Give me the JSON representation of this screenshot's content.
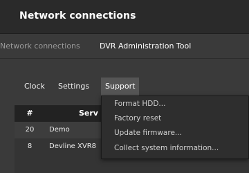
{
  "window": {
    "title": "Network connections"
  },
  "breadcrumbs": [
    "Network connections",
    "DVR Administration Tool"
  ],
  "menubar": {
    "items": [
      "Clock",
      "Settings",
      "Support"
    ],
    "active": "Support"
  },
  "support_menu": {
    "items": [
      "Format HDD...",
      "Factory reset",
      "Update firmware...",
      "Collect system information..."
    ]
  },
  "table": {
    "headers": {
      "num": "#",
      "server": "Serv"
    },
    "rows": [
      {
        "num": "20",
        "name": "Demo",
        "type": ""
      },
      {
        "num": "8",
        "name": "Devline XVR8",
        "type": "XVR8"
      }
    ]
  },
  "colors": {
    "titlebar_bg": "#2a2a2a",
    "body_bg": "#3a3a3a",
    "menu_active_bg": "#555555",
    "dropdown_bg": "#2e2e2e",
    "table_header_bg": "#222222"
  }
}
